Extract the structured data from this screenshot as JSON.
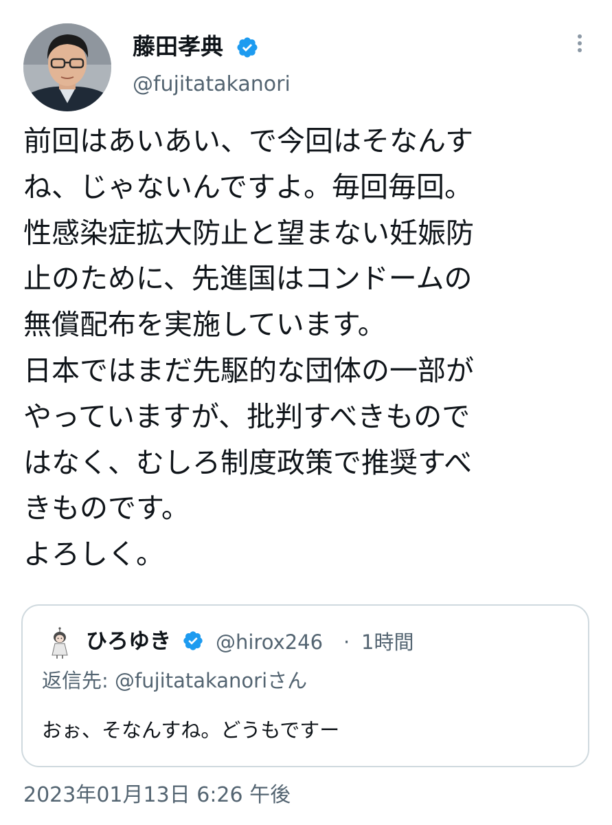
{
  "author": {
    "name": "藤田孝典",
    "handle": "@fujitatakanori",
    "verified": true
  },
  "tweet": {
    "lines": [
      "前回はあいあい、で今回はそなんす",
      "ね、じゃないんですよ。毎回毎回。",
      "性感染症拡大防止と望まない妊娠防",
      "止のために、先進国はコンドームの",
      "無償配布を実施しています。",
      "日本ではまだ先駆的な団体の一部が",
      "やっていますが、批判すべきもので",
      "はなく、むしろ制度政策で推奨すべ",
      "きものです。",
      "よろしく。"
    ],
    "timestamp": "2023年01月13日 6:26 午後"
  },
  "quoted_tweet": {
    "name": "ひろゆき",
    "handle": "@hirox246",
    "separator": "·",
    "time": "1時間",
    "verified": true,
    "reply_to": "返信先: @fujitatakanoriさん",
    "text": "おぉ、そなんすね。どうもですー"
  },
  "icons": {
    "verified": "verified-badge-icon",
    "more": "more-options-icon"
  },
  "colors": {
    "verified_blue": "#1d9bf0",
    "secondary_text": "#536471",
    "primary_text": "#0f1419",
    "border": "#cfd9de"
  }
}
